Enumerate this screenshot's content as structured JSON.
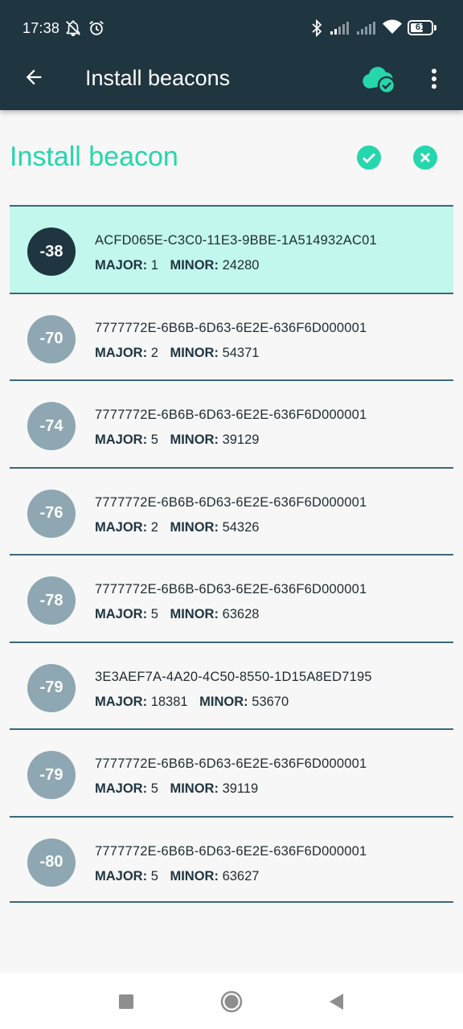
{
  "status_bar": {
    "time": "17:38",
    "battery_level": "61",
    "icons": [
      "notifications-off-icon",
      "alarm-icon",
      "bluetooth-icon",
      "signal-icon",
      "signal-icon",
      "wifi-icon",
      "battery-icon"
    ]
  },
  "app_bar": {
    "title": "Install beacons",
    "back_icon": "arrow-left-icon",
    "cloud_icon": "cloud-check-icon",
    "more_icon": "more-vert-icon"
  },
  "section": {
    "title": "Install beacon",
    "confirm_icon": "check-circle-icon",
    "cancel_icon": "close-circle-icon"
  },
  "labels": {
    "major": "MAJOR:",
    "minor": "MINOR:"
  },
  "beacons": [
    {
      "rssi": "-38",
      "uuid": "ACFD065E-C3C0-11E3-9BBE-1A514932AC01",
      "major": "1",
      "minor": "24280",
      "selected": true
    },
    {
      "rssi": "-70",
      "uuid": "7777772E-6B6B-6D63-6E2E-636F6D000001",
      "major": "2",
      "minor": "54371"
    },
    {
      "rssi": "-74",
      "uuid": "7777772E-6B6B-6D63-6E2E-636F6D000001",
      "major": "5",
      "minor": "39129"
    },
    {
      "rssi": "-76",
      "uuid": "7777772E-6B6B-6D63-6E2E-636F6D000001",
      "major": "2",
      "minor": "54326"
    },
    {
      "rssi": "-78",
      "uuid": "7777772E-6B6B-6D63-6E2E-636F6D000001",
      "major": "5",
      "minor": "63628"
    },
    {
      "rssi": "-79",
      "uuid": "3E3AEF7A-4A20-4C50-8550-1D15A8ED7195",
      "major": "18381",
      "minor": "53670"
    },
    {
      "rssi": "-79",
      "uuid": "7777772E-6B6B-6D63-6E2E-636F6D000001",
      "major": "5",
      "minor": "39119"
    },
    {
      "rssi": "-80",
      "uuid": "7777772E-6B6B-6D63-6E2E-636F6D000001",
      "major": "5",
      "minor": "63627"
    }
  ],
  "colors": {
    "primary_dark": "#1f3540",
    "accent": "#26d6ad",
    "selected_row": "#c2f7ed",
    "rssi_bubble": "#8ea7b2",
    "divider": "#3d6779"
  },
  "nav_bar": {
    "icons": [
      "recent-apps-icon",
      "home-icon",
      "back-triangle-icon"
    ]
  }
}
